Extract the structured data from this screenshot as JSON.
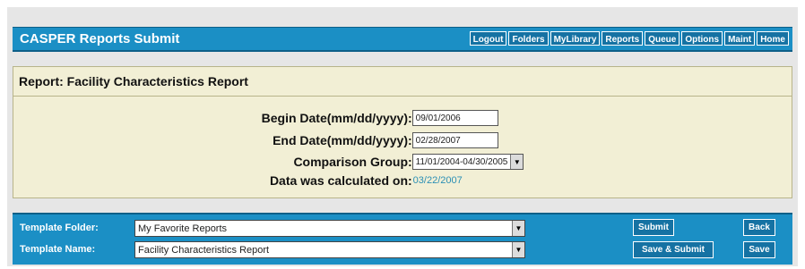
{
  "header": {
    "title": "CASPER Reports Submit",
    "nav": [
      "Logout",
      "Folders",
      "MyLibrary",
      "Reports",
      "Queue",
      "Options",
      "Maint",
      "Home"
    ]
  },
  "report": {
    "title": "Report: Facility Characteristics Report",
    "begin_date": {
      "label": "Begin Date(mm/dd/yyyy)",
      "value": "09/01/2006"
    },
    "end_date": {
      "label": "End Date(mm/dd/yyyy)",
      "value": "02/28/2007"
    },
    "comparison_group": {
      "label": "Comparison Group",
      "value": "11/01/2004-04/30/2005"
    },
    "calculated_on": {
      "label": "Data was calculated on",
      "value": "03/22/2007"
    },
    "colon": ":"
  },
  "template": {
    "folder_label": "Template Folder:",
    "folder_value": "My Favorite Reports",
    "name_label": "Template Name:",
    "name_value": "Facility Characteristics Report",
    "submit": "Submit",
    "back": "Back",
    "save_submit": "Save & Submit",
    "save": "Save"
  },
  "colors": {
    "header_blue": "#1b8fc5",
    "panel_beige": "#f2efd5",
    "link_blue": "#2a8fb5"
  },
  "icons": {
    "dropdown": "chevron-down-icon"
  }
}
